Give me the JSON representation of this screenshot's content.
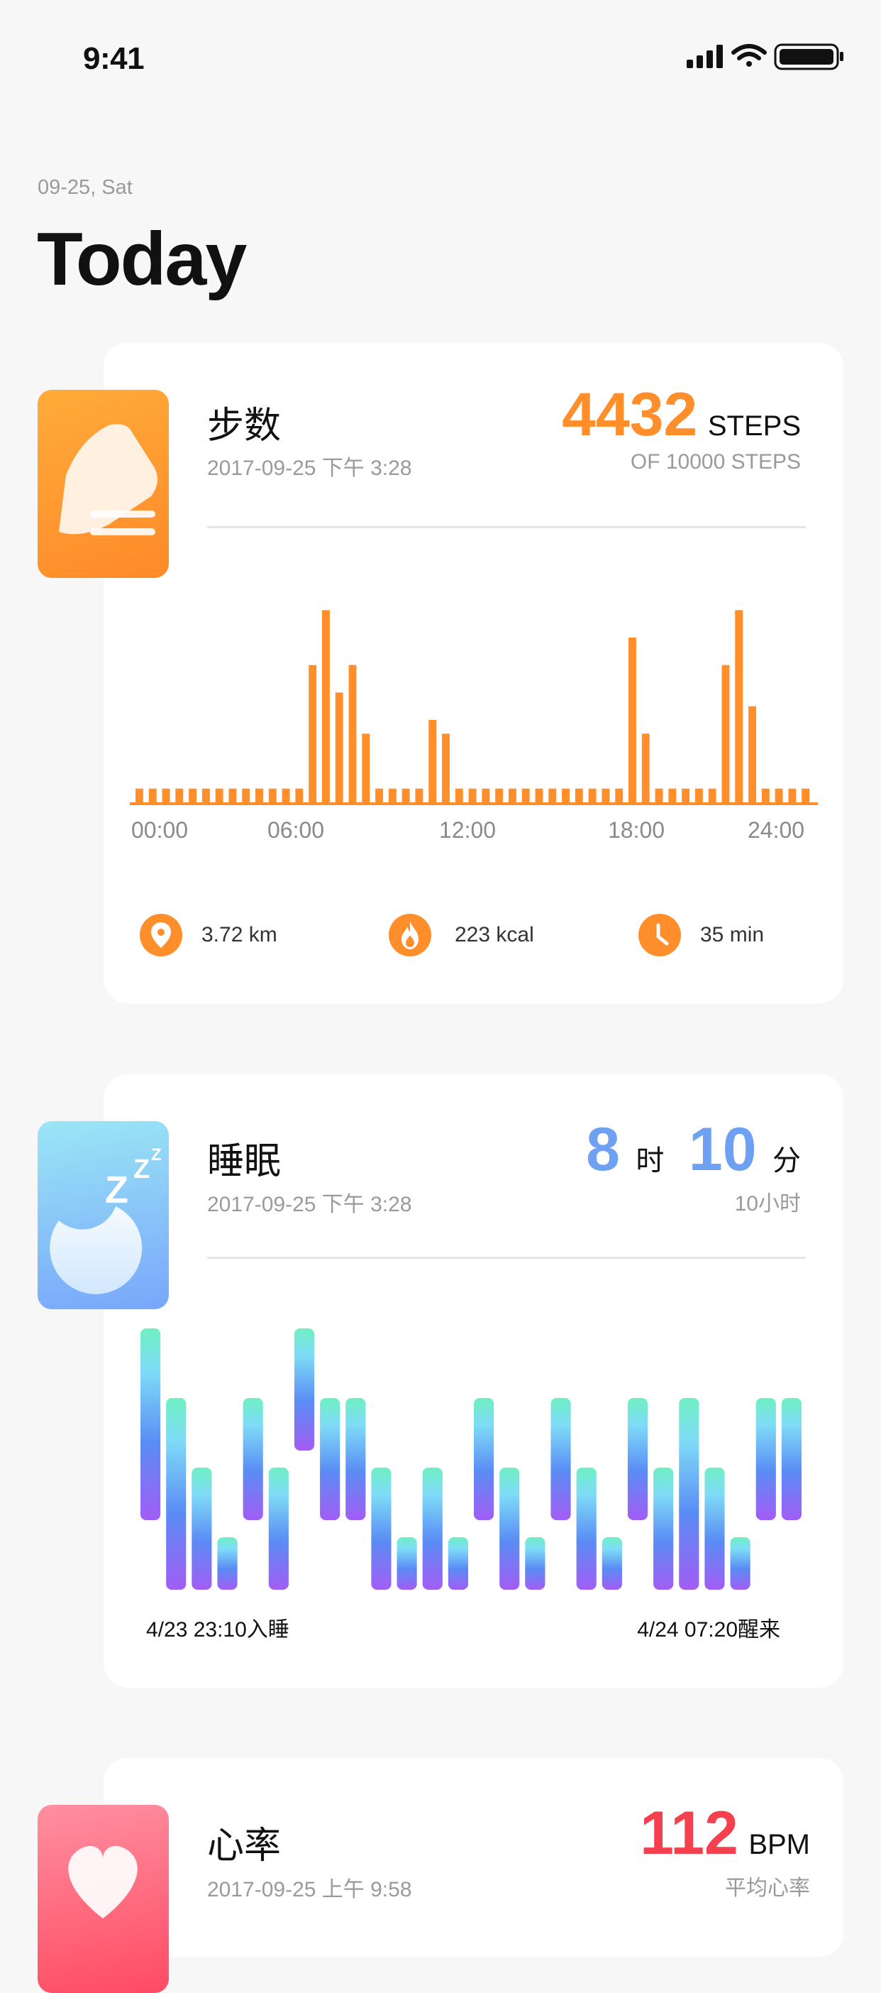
{
  "status_bar": {
    "time": "9:41"
  },
  "header": {
    "date": "09-25, Sat",
    "title": "Today"
  },
  "steps": {
    "title": "步数",
    "timestamp": "2017-09-25 下午 3:28",
    "value": "4432",
    "unit": "STEPS",
    "goal": "OF 10000 STEPS",
    "axis_labels": [
      "00:00",
      "06:00",
      "12:00",
      "18:00",
      "24:00"
    ],
    "stats": [
      {
        "icon": "location-pin-icon",
        "text": "3.72 km"
      },
      {
        "icon": "flame-icon",
        "text": "223 kcal"
      },
      {
        "icon": "clock-icon",
        "text": "35 min"
      }
    ],
    "accent": "#ff8e2b",
    "chart_data": {
      "type": "bar",
      "values": [
        1,
        1,
        1,
        1,
        1,
        1,
        1,
        1,
        1,
        1,
        1,
        1,
        1,
        10,
        14,
        8,
        10,
        5,
        1,
        1,
        1,
        1,
        6,
        5,
        1,
        1,
        1,
        1,
        1,
        1,
        1,
        1,
        1,
        1,
        1,
        1,
        1,
        12,
        5,
        1,
        1,
        1,
        1,
        1,
        10,
        14,
        7,
        1,
        1,
        1,
        1
      ],
      "ylim": [
        0,
        15
      ]
    }
  },
  "sleep": {
    "title": "睡眠",
    "timestamp": "2017-09-25 下午 3:28",
    "hours": "8",
    "hours_unit": "时",
    "minutes": "10",
    "minutes_unit": "分",
    "target": "10小时",
    "start_label": "4/23  23:10入睡",
    "end_label": "4/24  07:20醒来",
    "accent": "#6ea1f2",
    "chart_data": {
      "type": "area",
      "levels": [
        "awake",
        "light",
        "medium",
        "deep"
      ],
      "segments": [
        [
          0,
          2
        ],
        [
          1,
          3
        ],
        [
          2,
          4
        ],
        [
          3,
          4
        ],
        [
          1,
          2
        ],
        [
          2,
          3
        ],
        [
          0,
          1
        ],
        [
          1,
          2
        ],
        [
          1,
          2
        ],
        [
          2,
          3
        ],
        [
          3,
          3
        ],
        [
          2,
          3
        ],
        [
          3,
          3
        ],
        [
          1,
          2
        ],
        [
          2,
          3
        ],
        [
          3,
          3
        ],
        [
          1,
          2
        ],
        [
          2,
          3
        ],
        [
          3,
          3
        ],
        [
          1,
          2
        ],
        [
          2,
          3
        ],
        [
          1,
          3
        ],
        [
          2,
          3
        ],
        [
          3,
          3
        ],
        [
          1,
          2
        ],
        [
          1,
          2
        ]
      ]
    }
  },
  "heart": {
    "title": "心率",
    "timestamp": "2017-09-25 上午 9:58",
    "value": "112",
    "unit": "BPM",
    "caption": "平均心率",
    "accent": "#f5414f"
  }
}
